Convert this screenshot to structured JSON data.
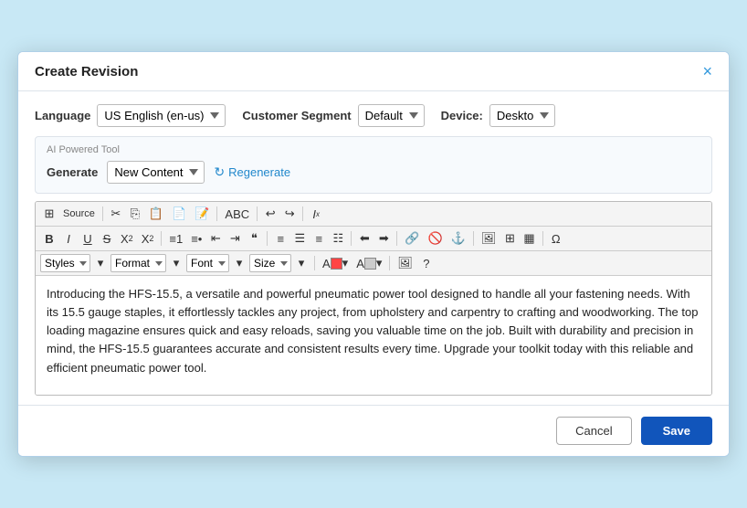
{
  "dialog": {
    "title": "Create Revision",
    "close_label": "×"
  },
  "header_row": {
    "language_label": "Language",
    "language_value": "US English (en-us)",
    "customer_segment_label": "Customer Segment",
    "customer_segment_value": "Default",
    "device_label": "Device:",
    "device_value": "Deskto"
  },
  "ai_tool": {
    "section_label": "AI Powered Tool",
    "generate_label": "Generate",
    "generate_value": "New Content",
    "regenerate_label": "Regenerate"
  },
  "toolbar": {
    "source_label": "Source",
    "rows": [
      [
        "add",
        "source",
        "cut",
        "copy",
        "paste-text",
        "paste-word",
        "find",
        "undo",
        "redo",
        "remove-format"
      ],
      [
        "bold",
        "italic",
        "underline",
        "strike",
        "sub",
        "super",
        "ol",
        "ul",
        "outdent",
        "indent",
        "blockquote",
        "align-left",
        "align-center",
        "align-right",
        "align-justify",
        "indent-left",
        "indent-right",
        "link",
        "unlink",
        "anchor",
        "image-icon",
        "table-icon",
        "table2",
        "special"
      ]
    ],
    "styles": [
      "Styles"
    ],
    "format": [
      "Format"
    ],
    "font": [
      "Font"
    ],
    "size": [
      "Size"
    ]
  },
  "editor": {
    "content": "Introducing the HFS-15.5, a versatile and powerful pneumatic power tool designed to handle all your fastening needs. With its 15.5 gauge staples, it effortlessly tackles any project, from upholstery and carpentry to crafting and woodworking. The top loading magazine ensures quick and easy reloads, saving you valuable time on the job. Built with durability and precision in mind, the HFS-15.5 guarantees accurate and consistent results every time. Upgrade your toolkit today with this reliable and efficient pneumatic power tool."
  },
  "footer": {
    "cancel_label": "Cancel",
    "save_label": "Save"
  }
}
